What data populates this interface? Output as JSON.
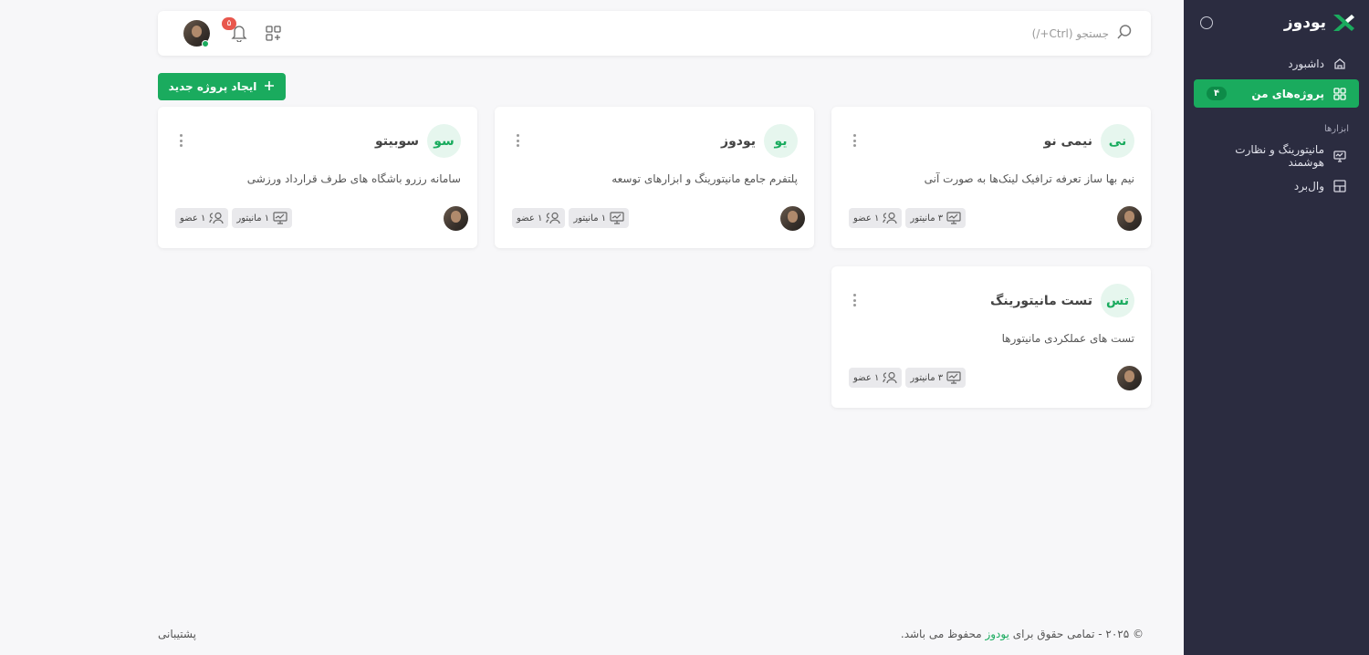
{
  "brand": {
    "name": "یودوز",
    "accent": "#1aab5e",
    "sidebar_bg": "#2b2c40"
  },
  "sidebar": {
    "items": [
      {
        "label": "داشبورد",
        "icon": "home-icon"
      },
      {
        "label": "پروژه‌های من",
        "icon": "grid-icon",
        "badge": "۴",
        "active": true
      }
    ],
    "tools_title": "ابزارها",
    "tools": [
      {
        "label": "مانیتورینگ و نظارت هوشمند",
        "icon": "monitor-icon"
      },
      {
        "label": "وال‌برد",
        "icon": "board-icon"
      }
    ]
  },
  "header": {
    "search_placeholder": "جستجو (Ctrl+/)",
    "notification_count": "۵"
  },
  "actions": {
    "new_project": "ایجاد پروژه جدید"
  },
  "projects": [
    {
      "initials": "نی",
      "title": "نیمی نو",
      "description": "نیم بها ساز تعرفه ترافیک لینک‌ها به صورت آنی",
      "monitors": "۳ مانیتور",
      "members": "۱ عضو"
    },
    {
      "initials": "یو",
      "title": "یودوز",
      "description": "پلتفرم جامع مانیتورینگ و ابزارهای توسعه",
      "monitors": "۱ مانیتور",
      "members": "۱ عضو"
    },
    {
      "initials": "سو",
      "title": "سوبیتو",
      "description": "سامانه رزرو باشگاه های طرف قرارداد ورزشی",
      "monitors": "۱ مانیتور",
      "members": "۱ عضو"
    },
    {
      "initials": "تس",
      "title": "تست مانیتورینگ",
      "description": "تست های عملکردی مانیتورها",
      "monitors": "۳ مانیتور",
      "members": "۱ عضو"
    }
  ],
  "footer": {
    "copyright_prefix": "© ۲۰۲۵ - تمامی حقوق برای ",
    "copyright_brand": "یودوز",
    "copyright_suffix": " محفوظ می باشد.",
    "support": "پشتیبانی"
  }
}
